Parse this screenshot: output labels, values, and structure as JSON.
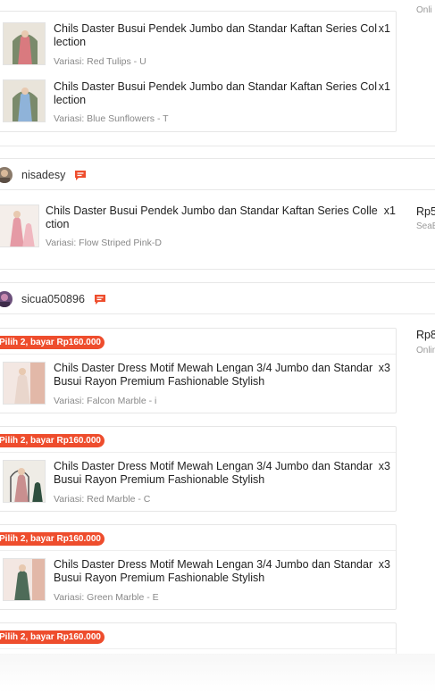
{
  "top_group": {
    "cut_text": "Onli",
    "items": [
      {
        "name": "Chils Daster Busui Pendek Jumbo dan Standar Kaftan Series Collection",
        "qty": "x1",
        "variant": "Variasi: Red Tulips - U"
      },
      {
        "name": "Chils Daster Busui Pendek Jumbo dan Standar Kaftan Series Collection",
        "qty": "x1",
        "variant": "Variasi: Blue Sunflowers - T"
      }
    ]
  },
  "order_1": {
    "username": "nisadesy",
    "item": {
      "name": "Chils Daster Busui Pendek Jumbo dan Standar Kaftan Series Collection",
      "qty": "x1",
      "variant": "Variasi: Flow Striped Pink-D"
    },
    "price": "Rp5",
    "shipping": "SeaB"
  },
  "order_2": {
    "username": "sicua050896",
    "price": "Rp8",
    "shipping": "Onlin",
    "items": [
      {
        "promo": "Pilih 2, bayar Rp160.000",
        "name": "Chils Daster Dress Motif Mewah Lengan 3/4 Jumbo dan Standar Busui Rayon Premium Fashionable Stylish",
        "qty": "x3",
        "variant": "Variasi: Falcon Marble - i"
      },
      {
        "promo": "Pilih 2, bayar Rp160.000",
        "name": "Chils Daster Dress Motif Mewah Lengan 3/4 Jumbo dan Standar Busui Rayon Premium Fashionable Stylish",
        "qty": "x3",
        "variant": "Variasi: Red Marble - C"
      },
      {
        "promo": "Pilih 2, bayar Rp160.000",
        "name": "Chils Daster Dress Motif Mewah Lengan 3/4 Jumbo dan Standar Busui Rayon Premium Fashionable Stylish",
        "qty": "x3",
        "variant": "Variasi: Green Marble - E"
      },
      {
        "promo": "Pilih 2, bayar Rp160.000"
      }
    ]
  },
  "colors": {
    "accent": "#ee4d2d",
    "chat_icon": "#ee4d2d",
    "border": "#e6e6e6",
    "muted_text": "#888888"
  },
  "icons": {
    "chat": "chat-bubble-icon",
    "avatar": "user-avatar"
  }
}
